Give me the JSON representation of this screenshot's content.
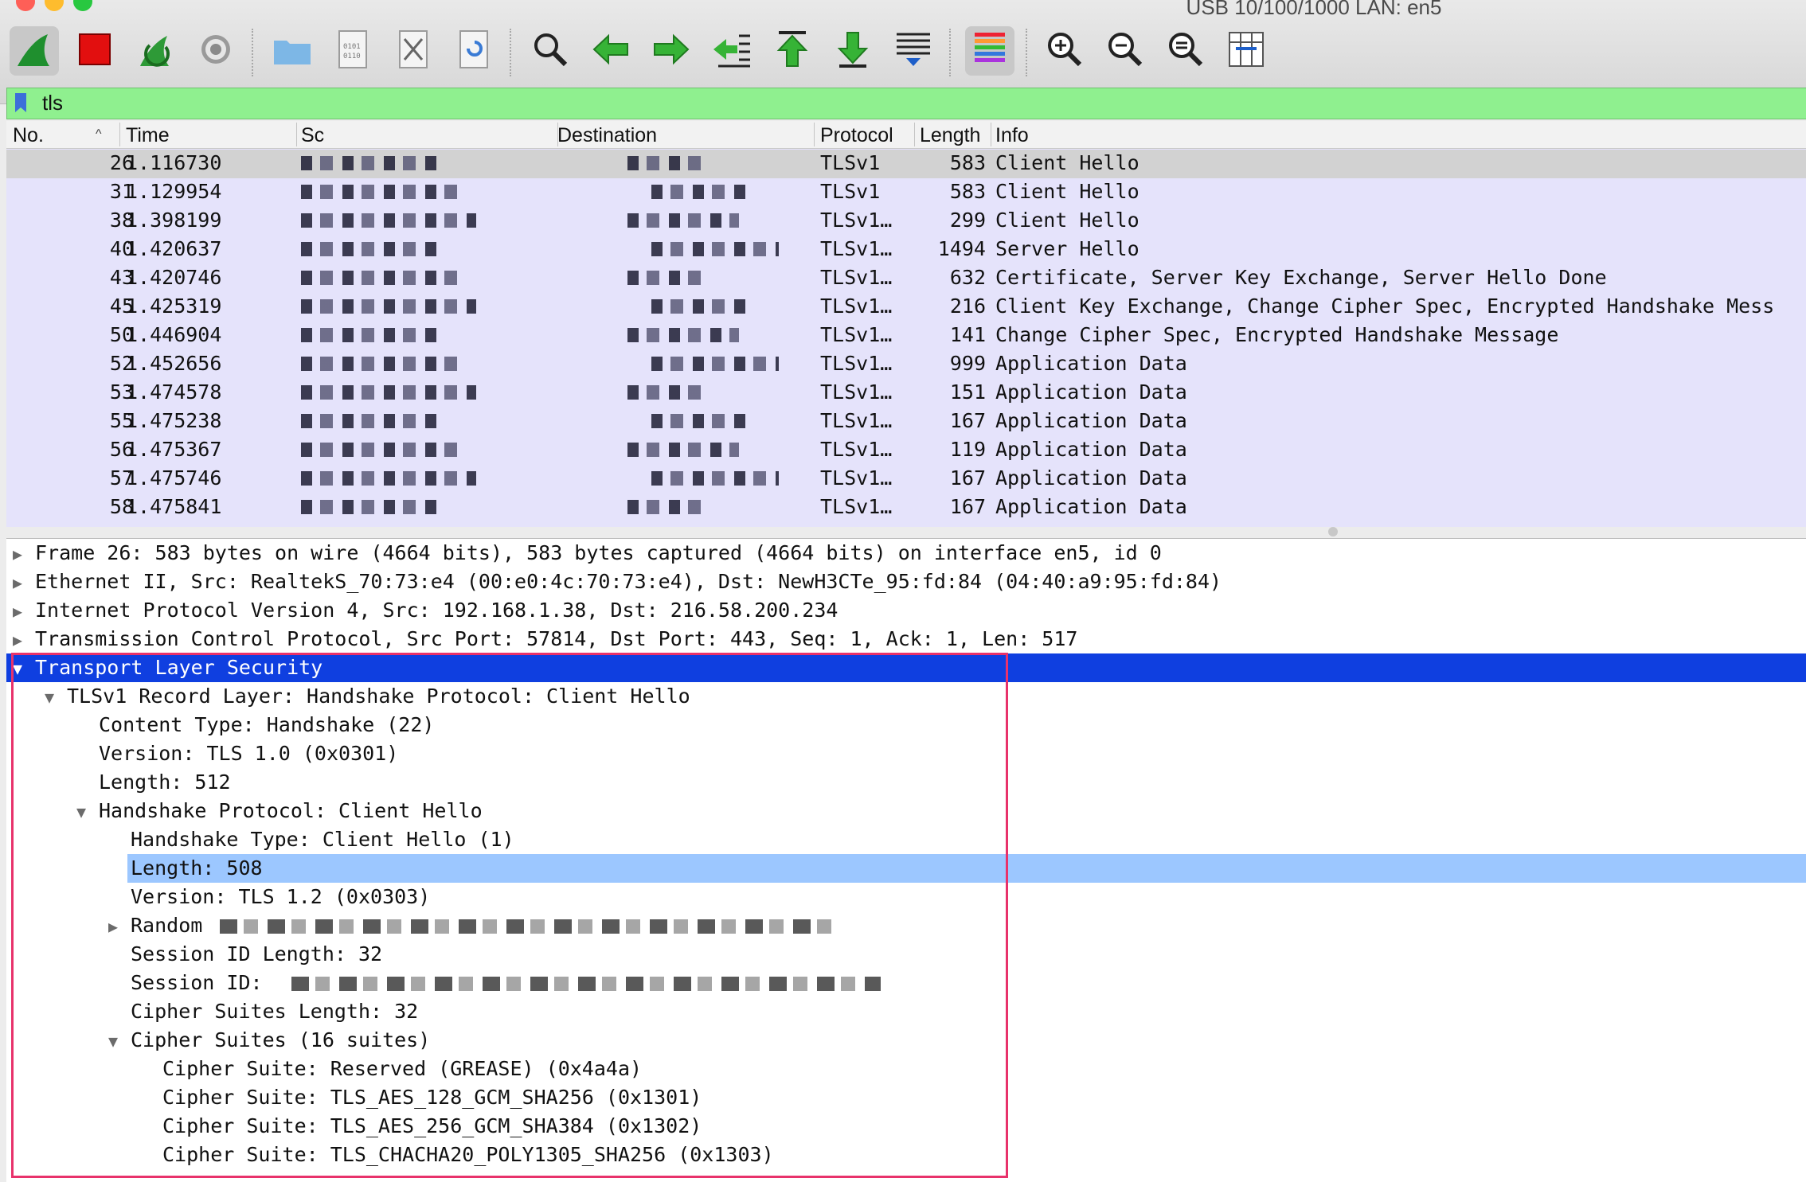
{
  "window": {
    "title": "USB 10/100/1000 LAN: en5"
  },
  "toolbar": {
    "buttons": [
      {
        "icon": "shark-fin-start-icon"
      },
      {
        "icon": "stop-capture-icon"
      },
      {
        "icon": "restart-capture-icon"
      },
      {
        "icon": "capture-options-gear-icon"
      },
      {
        "icon": "open-folder-icon"
      },
      {
        "icon": "save-file-icon"
      },
      {
        "icon": "close-file-icon"
      },
      {
        "icon": "reload-file-icon"
      },
      {
        "icon": "find-packet-icon"
      },
      {
        "icon": "go-back-icon"
      },
      {
        "icon": "go-forward-icon"
      },
      {
        "icon": "go-to-packet-icon"
      },
      {
        "icon": "go-first-icon"
      },
      {
        "icon": "go-last-icon"
      },
      {
        "icon": "autoscroll-icon"
      },
      {
        "icon": "colorize-icon"
      },
      {
        "icon": "zoom-in-icon"
      },
      {
        "icon": "zoom-out-icon"
      },
      {
        "icon": "zoom-normal-icon"
      },
      {
        "icon": "resize-columns-icon"
      }
    ]
  },
  "filter": {
    "value": "tls"
  },
  "packet_list": {
    "columns": [
      "No.",
      "Time",
      "Sc",
      "Destination",
      "Protocol",
      "Length",
      "Info"
    ],
    "rows": [
      {
        "no": "26",
        "time": "1.116730",
        "protocol": "TLSv1",
        "length": "583",
        "info": "Client Hello",
        "selected": true
      },
      {
        "no": "31",
        "time": "1.129954",
        "protocol": "TLSv1",
        "length": "583",
        "info": "Client Hello"
      },
      {
        "no": "38",
        "time": "1.398199",
        "protocol": "TLSv1…",
        "length": "299",
        "info": "Client Hello"
      },
      {
        "no": "40",
        "time": "1.420637",
        "protocol": "TLSv1…",
        "length": "1494",
        "info": "Server Hello"
      },
      {
        "no": "43",
        "time": "1.420746",
        "protocol": "TLSv1…",
        "length": "632",
        "info": "Certificate, Server Key Exchange, Server Hello Done"
      },
      {
        "no": "45",
        "time": "1.425319",
        "protocol": "TLSv1…",
        "length": "216",
        "info": "Client Key Exchange, Change Cipher Spec, Encrypted Handshake Mess"
      },
      {
        "no": "50",
        "time": "1.446904",
        "protocol": "TLSv1…",
        "length": "141",
        "info": "Change Cipher Spec, Encrypted Handshake Message"
      },
      {
        "no": "52",
        "time": "1.452656",
        "protocol": "TLSv1…",
        "length": "999",
        "info": "Application Data"
      },
      {
        "no": "53",
        "time": "1.474578",
        "protocol": "TLSv1…",
        "length": "151",
        "info": "Application Data"
      },
      {
        "no": "55",
        "time": "1.475238",
        "protocol": "TLSv1…",
        "length": "167",
        "info": "Application Data"
      },
      {
        "no": "56",
        "time": "1.475367",
        "protocol": "TLSv1…",
        "length": "119",
        "info": "Application Data"
      },
      {
        "no": "57",
        "time": "1.475746",
        "protocol": "TLSv1…",
        "length": "167",
        "info": "Application Data"
      },
      {
        "no": "58",
        "time": "1.475841",
        "protocol": "TLSv1…",
        "length": "167",
        "info": "Application Data"
      }
    ]
  },
  "details": {
    "lines": [
      {
        "text": "Frame 26: 583 bytes on wire (4664 bits), 583 bytes captured (4664 bits) on interface en5, id 0",
        "indent": 0,
        "toggle": "collapsed"
      },
      {
        "text": "Ethernet II, Src: RealtekS_70:73:e4 (00:e0:4c:70:73:e4), Dst: NewH3CTe_95:fd:84 (04:40:a9:95:fd:84)",
        "indent": 0,
        "toggle": "collapsed"
      },
      {
        "text": "Internet Protocol Version 4, Src: 192.168.1.38, Dst: 216.58.200.234",
        "indent": 0,
        "toggle": "collapsed"
      },
      {
        "text": "Transmission Control Protocol, Src Port: 57814, Dst Port: 443, Seq: 1, Ack: 1, Len: 517",
        "indent": 0,
        "toggle": "collapsed"
      },
      {
        "text": "Transport Layer Security",
        "indent": 0,
        "toggle": "expanded",
        "highlight": "dark"
      },
      {
        "text": "TLSv1 Record Layer: Handshake Protocol: Client Hello",
        "indent": 1,
        "toggle": "expanded"
      },
      {
        "text": "Content Type: Handshake (22)",
        "indent": 2
      },
      {
        "text": "Version: TLS 1.0 (0x0301)",
        "indent": 2
      },
      {
        "text": "Length: 512",
        "indent": 2
      },
      {
        "text": "Handshake Protocol: Client Hello",
        "indent": 2,
        "toggle": "expanded"
      },
      {
        "text": "Handshake Type: Client Hello (1)",
        "indent": 3
      },
      {
        "text": "Length: 508",
        "indent": 3,
        "highlight": "light"
      },
      {
        "text": "Version: TLS 1.2 (0x0303)",
        "indent": 3
      },
      {
        "text": "Random",
        "indent": 3,
        "toggle": "collapsed",
        "redacted": true
      },
      {
        "text": "Session ID Length: 32",
        "indent": 3
      },
      {
        "text": "Session ID:",
        "indent": 3,
        "redacted": true
      },
      {
        "text": "Cipher Suites Length: 32",
        "indent": 3
      },
      {
        "text": "Cipher Suites (16 suites)",
        "indent": 3,
        "toggle": "expanded"
      },
      {
        "text": "Cipher Suite: Reserved (GREASE) (0x4a4a)",
        "indent": 4
      },
      {
        "text": "Cipher Suite: TLS_AES_128_GCM_SHA256 (0x1301)",
        "indent": 4
      },
      {
        "text": "Cipher Suite: TLS_AES_256_GCM_SHA384 (0x1302)",
        "indent": 4
      },
      {
        "text": "Cipher Suite: TLS_CHACHA20_POLY1305_SHA256 (0x1303)",
        "indent": 4
      }
    ]
  },
  "colors": {
    "filter_ok": "#8ff08f",
    "row_bg": "#e5e3fb",
    "selected_dark": "#0f3fe0",
    "selected_light": "#9cc7ff",
    "annotation": "#e8326b"
  }
}
